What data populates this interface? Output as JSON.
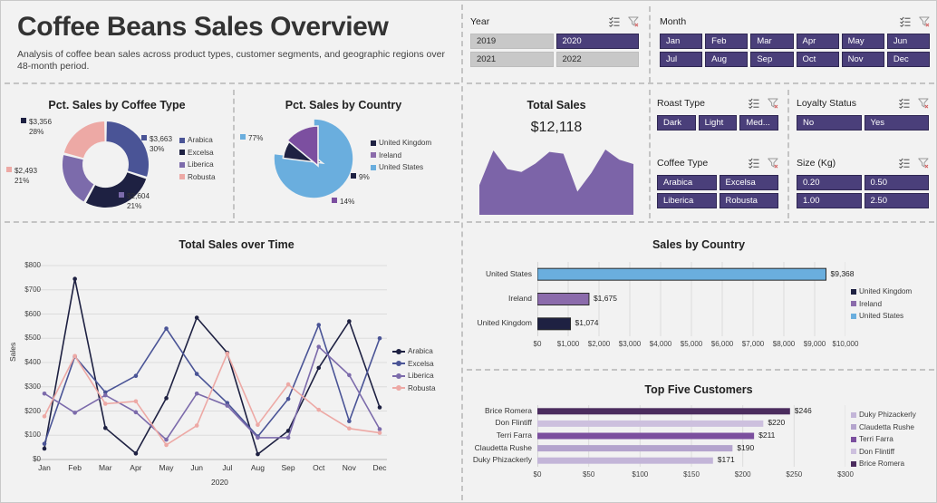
{
  "header": {
    "title": "Coffee Beans Sales Overview",
    "subtitle": "Analysis of coffee bean sales across product types, customer segments, and geographic regions over 48-month period."
  },
  "filters": [
    {
      "name": "year",
      "title": "Year",
      "columns": 2,
      "icons": [
        "multi-select-icon",
        "clear-filter-icon"
      ],
      "options": [
        {
          "label": "2019",
          "selected": false
        },
        {
          "label": "2020",
          "selected": true
        },
        {
          "label": "2021",
          "selected": false
        },
        {
          "label": "2022",
          "selected": false
        }
      ]
    },
    {
      "name": "month",
      "title": "Month",
      "columns": 6,
      "icons": [
        "multi-select-icon",
        "clear-filter-icon"
      ],
      "options": [
        {
          "label": "Jan",
          "selected": true
        },
        {
          "label": "Feb",
          "selected": true
        },
        {
          "label": "Mar",
          "selected": true
        },
        {
          "label": "Apr",
          "selected": true
        },
        {
          "label": "May",
          "selected": true
        },
        {
          "label": "Jun",
          "selected": true
        },
        {
          "label": "Jul",
          "selected": true
        },
        {
          "label": "Aug",
          "selected": true
        },
        {
          "label": "Sep",
          "selected": true
        },
        {
          "label": "Oct",
          "selected": true
        },
        {
          "label": "Nov",
          "selected": true
        },
        {
          "label": "Dec",
          "selected": true
        }
      ]
    },
    {
      "name": "roast-type",
      "title": "Roast Type",
      "columns": 3,
      "icons": [
        "multi-select-icon",
        "clear-filter-icon"
      ],
      "options": [
        {
          "label": "Dark",
          "selected": true
        },
        {
          "label": "Light",
          "selected": true
        },
        {
          "label": "Med...",
          "selected": true
        }
      ]
    },
    {
      "name": "loyalty-status",
      "title": "Loyalty Status",
      "columns": 2,
      "icons": [
        "multi-select-icon",
        "clear-filter-icon"
      ],
      "options": [
        {
          "label": "No",
          "selected": true
        },
        {
          "label": "Yes",
          "selected": true
        }
      ]
    },
    {
      "name": "coffee-type",
      "title": "Coffee Type",
      "columns": 2,
      "icons": [
        "multi-select-icon",
        "clear-filter-icon"
      ],
      "options": [
        {
          "label": "Arabica",
          "selected": true
        },
        {
          "label": "Excelsa",
          "selected": true
        },
        {
          "label": "Liberica",
          "selected": true
        },
        {
          "label": "Robusta",
          "selected": true
        }
      ]
    },
    {
      "name": "size-kg",
      "title": "Size (Kg)",
      "columns": 2,
      "icons": [
        "multi-select-icon",
        "clear-filter-icon"
      ],
      "options": [
        {
          "label": "0.20",
          "selected": true
        },
        {
          "label": "0.50",
          "selected": true
        },
        {
          "label": "1.00",
          "selected": true
        },
        {
          "label": "2.50",
          "selected": true
        }
      ]
    }
  ],
  "kpi": {
    "label": "Total Sales",
    "value": "$12,118"
  },
  "colors": {
    "arabica": "#4a5496",
    "excelsa": "#1e2142",
    "liberica": "#7c6bab",
    "robusta": "#eda9a5",
    "united_states": "#6aaede",
    "ireland": "#8b6bab",
    "united_kingdom": "#1e2142",
    "accent_purple": "#7c64a8",
    "chip_selected": "#4a3f7a",
    "chip_unselected": "#c8c8c8",
    "background": "#f2f2f2"
  },
  "chart_data": [
    {
      "name": "pct-sales-by-coffee-type",
      "type": "pie",
      "title": "Pct. Sales by Coffee Type",
      "donut": true,
      "labels": [
        "Arabica",
        "Excelsa",
        "Liberica",
        "Robusta"
      ],
      "values": [
        3663,
        3356,
        2604,
        2493
      ],
      "percentages": [
        30,
        28,
        21,
        21
      ],
      "value_labels": [
        "$3,663",
        "$3,356",
        "$2,604",
        "$2,493"
      ],
      "percent_labels": [
        "30%",
        "28%",
        "21%",
        "21%"
      ],
      "colors": [
        "#4a5496",
        "#1e2142",
        "#7c6bab",
        "#eda9a5"
      ],
      "legend": [
        "Arabica",
        "Excelsa",
        "Liberica",
        "Robusta"
      ],
      "legend_position": "right"
    },
    {
      "name": "pct-sales-by-country",
      "type": "pie",
      "title": "Pct. Sales by Country",
      "donut": false,
      "labels": [
        "United States",
        "Ireland",
        "United Kingdom"
      ],
      "percentages": [
        77,
        14,
        9
      ],
      "percent_labels": [
        "77%",
        "14%",
        "9%"
      ],
      "colors": [
        "#6aaede",
        "#8b6bab",
        "#1e2142"
      ],
      "legend": [
        "United Kingdom",
        "Ireland",
        "United States"
      ],
      "legend_colors": [
        "#1e2142",
        "#8b6bab",
        "#6aaede"
      ],
      "legend_position": "right"
    },
    {
      "name": "total-sales-sparkline",
      "type": "area",
      "title": "Total Sales",
      "x": [
        "Jan",
        "Feb",
        "Mar",
        "Apr",
        "May",
        "Jun",
        "Jul",
        "Aug",
        "Sep",
        "Oct",
        "Nov",
        "Dec"
      ],
      "values": [
        560,
        1300,
        900,
        840,
        1020,
        1270,
        1230,
        420,
        820,
        1320,
        1100,
        1010
      ],
      "color": "#7c64a8",
      "axes_visible": false
    },
    {
      "name": "total-sales-over-time",
      "type": "line",
      "title": "Total Sales over Time",
      "xlabel": "2020",
      "ylabel": "Sales",
      "categories": [
        "Jan",
        "Feb",
        "Mar",
        "Apr",
        "May",
        "Jun",
        "Jul",
        "Aug",
        "Sep",
        "Oct",
        "Nov",
        "Dec"
      ],
      "ylim": [
        0,
        800
      ],
      "yticks": [
        "$0",
        "$100",
        "$200",
        "$300",
        "$400",
        "$500",
        "$600",
        "$700",
        "$800"
      ],
      "grid": true,
      "legend_position": "right",
      "series": [
        {
          "name": "Arabica",
          "color": "#1e2142",
          "values": [
            45,
            745,
            130,
            25,
            253,
            585,
            440,
            22,
            118,
            378,
            570,
            215
          ]
        },
        {
          "name": "Excelsa",
          "color": "#4a5496",
          "values": [
            65,
            425,
            277,
            345,
            540,
            353,
            233,
            95,
            250,
            555,
            158,
            500
          ]
        },
        {
          "name": "Liberica",
          "color": "#7c6bab",
          "values": [
            272,
            193,
            265,
            195,
            82,
            272,
            222,
            90,
            90,
            465,
            348,
            125
          ]
        },
        {
          "name": "Robusta",
          "color": "#eda9a5",
          "values": [
            178,
            427,
            230,
            240,
            60,
            140,
            437,
            143,
            310,
            205,
            128,
            110
          ]
        }
      ]
    },
    {
      "name": "sales-by-country",
      "type": "bar",
      "orientation": "horizontal",
      "title": "Sales by Country",
      "categories": [
        "United States",
        "Ireland",
        "United Kingdom"
      ],
      "values": [
        9368,
        1675,
        1074
      ],
      "value_labels": [
        "$9,368",
        "$1,675",
        "$1,074"
      ],
      "colors": [
        "#6aaede",
        "#8b6bab",
        "#1e2142"
      ],
      "xlim": [
        0,
        10000
      ],
      "xticks": [
        "$0",
        "$1,000",
        "$2,000",
        "$3,000",
        "$4,000",
        "$5,000",
        "$6,000",
        "$7,000",
        "$8,000",
        "$9,000",
        "$10,000"
      ],
      "legend": [
        "United Kingdom",
        "Ireland",
        "United States"
      ],
      "legend_colors": [
        "#1e2142",
        "#8b6bab",
        "#6aaede"
      ],
      "legend_position": "right"
    },
    {
      "name": "top-five-customers",
      "type": "bar",
      "orientation": "horizontal",
      "title": "Top Five Customers",
      "categories": [
        "Brice Romera",
        "Don Flintiff",
        "Terri Farra",
        "Claudetta Rushe",
        "Duky Phizackerly"
      ],
      "values": [
        246,
        220,
        211,
        190,
        171
      ],
      "value_labels": [
        "$246",
        "$220",
        "$211",
        "$190",
        "$171"
      ],
      "colors": [
        "#4b2c5e",
        "#cdc0de",
        "#7b4f9e",
        "#b4a4cd",
        "#c3b5d8"
      ],
      "xlim": [
        0,
        300
      ],
      "xticks": [
        "$0",
        "$50",
        "$100",
        "$150",
        "$200",
        "$250",
        "$300"
      ],
      "legend": [
        "Duky Phizackerly",
        "Claudetta Rushe",
        "Terri Farra",
        "Don Flintiff",
        "Brice Romera"
      ],
      "legend_colors": [
        "#c3b5d8",
        "#b4a4cd",
        "#7b4f9e",
        "#cdc0de",
        "#4b2c5e"
      ],
      "legend_position": "right"
    }
  ]
}
